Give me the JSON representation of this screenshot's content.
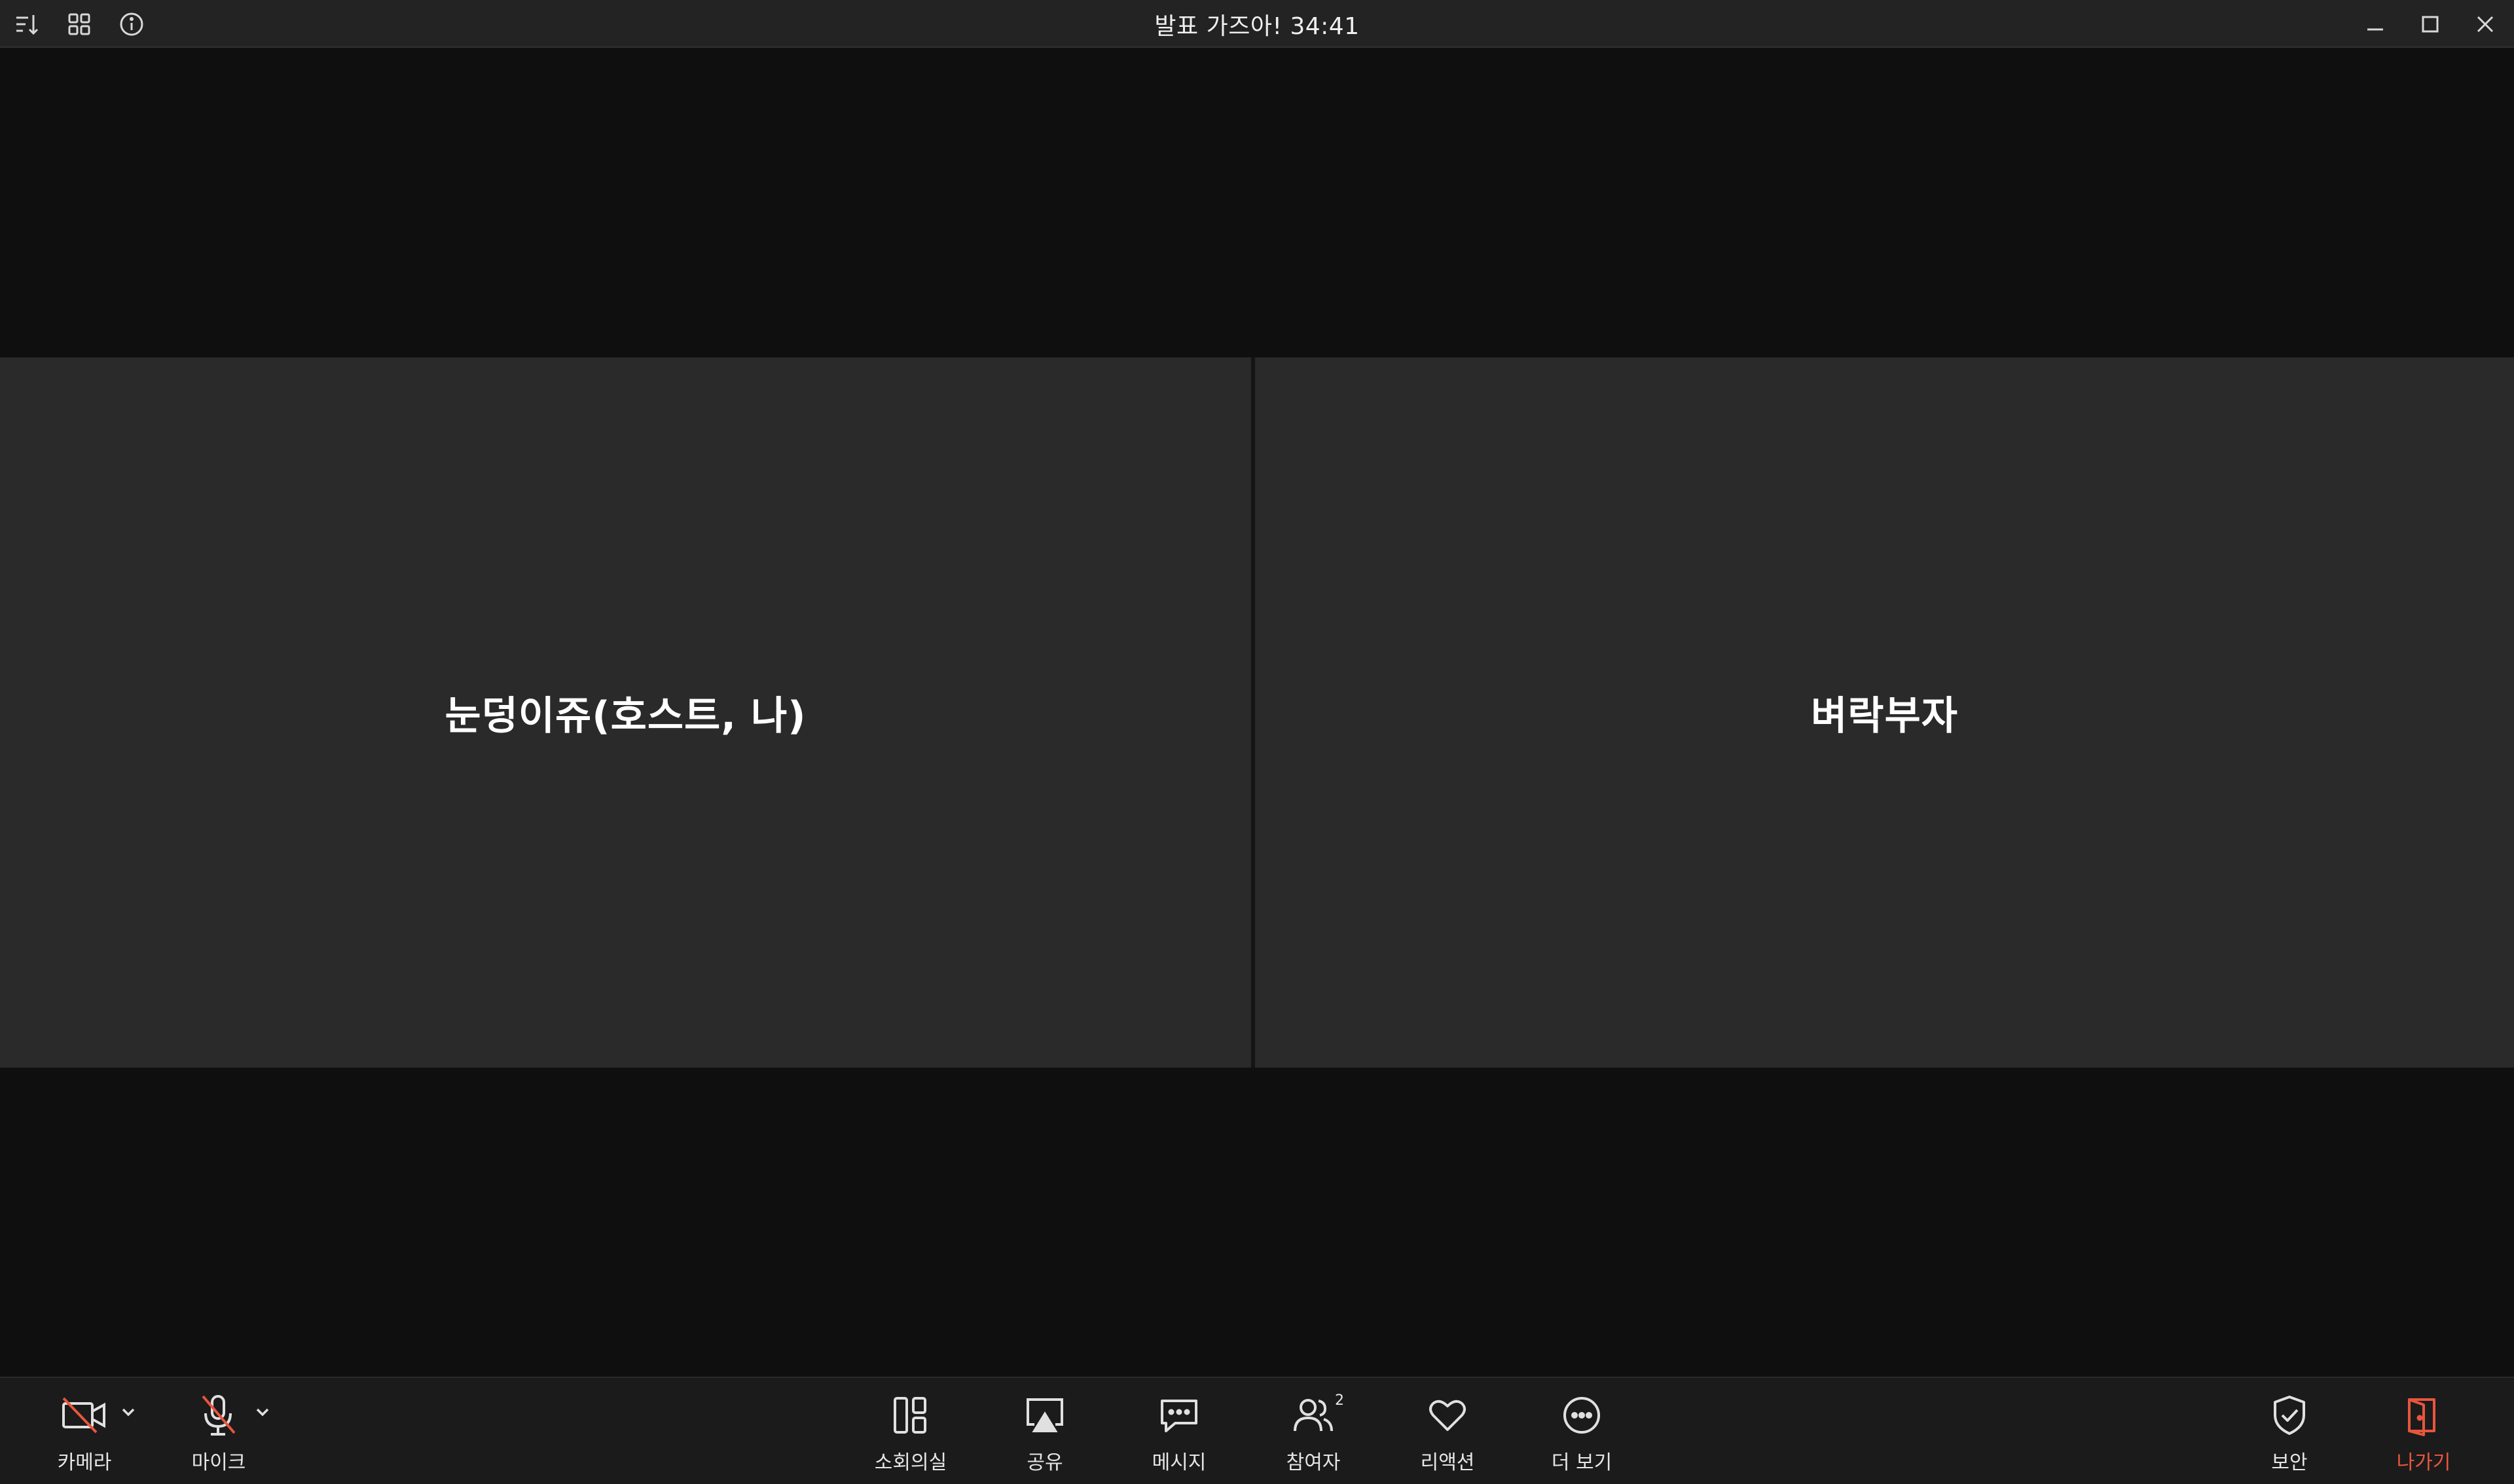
{
  "window": {
    "title": "발표 가즈아! 34:41"
  },
  "participants": [
    {
      "name": "눈덩이쥬(호스트, 나)"
    },
    {
      "name": "벼락부자"
    }
  ],
  "toolbar": {
    "camera_label": "카메라",
    "mic_label": "마이크",
    "breakout_label": "소회의실",
    "share_label": "공유",
    "chat_label": "메시지",
    "participants_label": "참여자",
    "participants_count": "2",
    "reactions_label": "리액션",
    "more_label": "더 보기",
    "security_label": "보안",
    "leave_label": "나가기"
  },
  "colors": {
    "accent_danger": "#e8553e",
    "tile_bg": "#2a2a2a",
    "stage_bg": "#0f0f10"
  }
}
